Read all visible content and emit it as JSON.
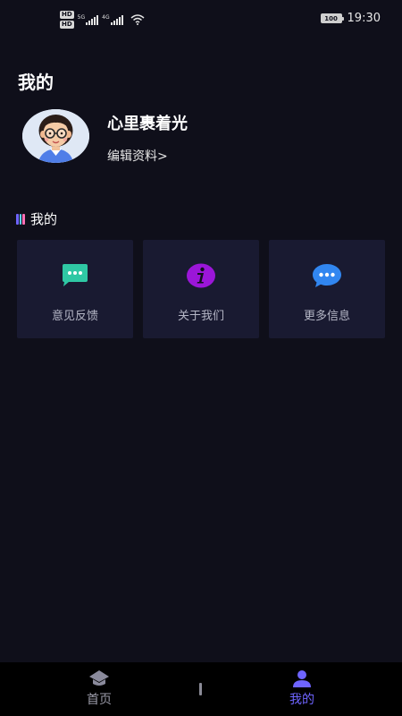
{
  "status_bar": {
    "hd_labels": [
      "HD",
      "HD"
    ],
    "network_labels": [
      "5G",
      "4G"
    ],
    "battery": "100",
    "time": "19:30"
  },
  "page": {
    "title": "我的"
  },
  "profile": {
    "nickname": "心里裹着光",
    "edit_label": "编辑资料>"
  },
  "section": {
    "title": "我的",
    "cards": [
      {
        "label": "意见反馈",
        "icon": "chat-bubble-icon",
        "color": "#2fc8a4"
      },
      {
        "label": "关于我们",
        "icon": "info-icon",
        "color": "#9b16d8"
      },
      {
        "label": "更多信息",
        "icon": "more-icon",
        "color": "#3186f0"
      }
    ]
  },
  "bottom_nav": {
    "items": [
      {
        "label": "首页",
        "icon": "home-icon",
        "active": false
      },
      {
        "label": "我的",
        "icon": "user-icon",
        "active": true
      }
    ]
  },
  "colors": {
    "background": "#0f0f1a",
    "card": "#191a31",
    "accent": "#6e64ff"
  }
}
